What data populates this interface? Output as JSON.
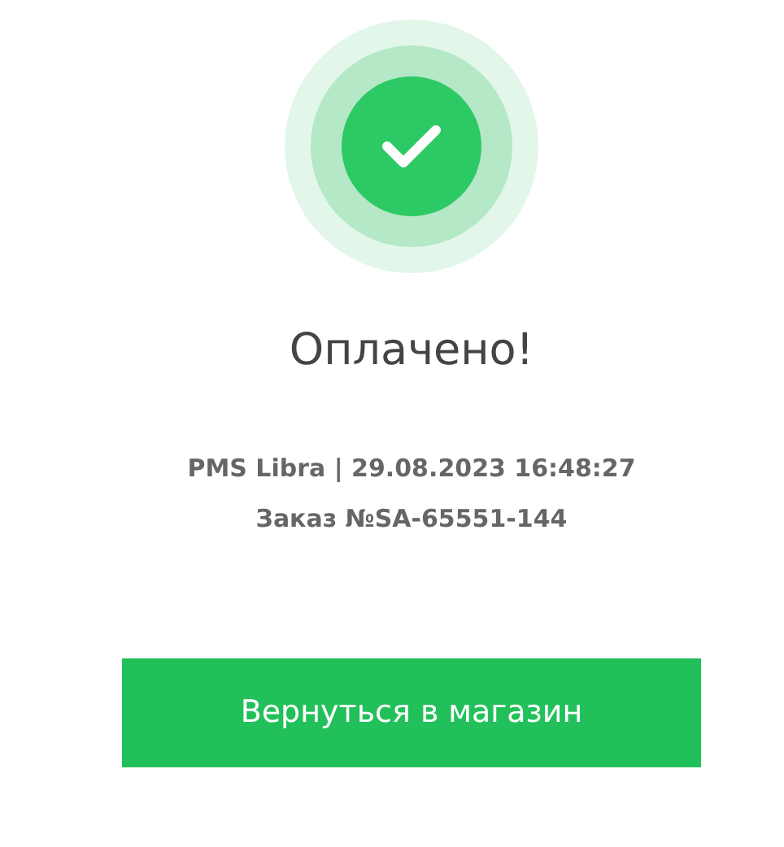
{
  "title": "Оплачено!",
  "details": [
    "PMS Libra | 29.08.2023 16:48:27",
    "Заказ №SA-65551-144"
  ],
  "button": {
    "label": "Вернуться в магазин"
  }
}
